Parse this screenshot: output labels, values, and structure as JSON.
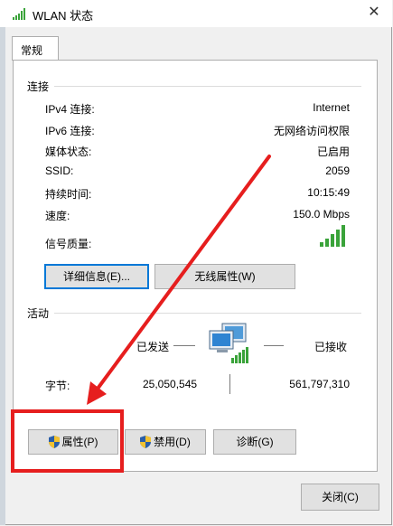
{
  "window": {
    "title": "WLAN 状态",
    "close_label": "✕"
  },
  "tabs": [
    {
      "label": "常规"
    }
  ],
  "connection": {
    "heading": "连接",
    "rows": [
      {
        "label": "IPv4 连接:",
        "value": "Internet"
      },
      {
        "label": "IPv6 连接:",
        "value": "无网络访问权限"
      },
      {
        "label": "媒体状态:",
        "value": "已启用"
      },
      {
        "label": "SSID:",
        "value": "2059"
      },
      {
        "label": "持续时间:",
        "value": "10:15:49"
      },
      {
        "label": "速度:",
        "value": "150.0 Mbps"
      }
    ],
    "signal_label": "信号质量:",
    "signal_bars": 5,
    "details_button": "详细信息(E)...",
    "wireless_props_button": "无线属性(W)"
  },
  "activity": {
    "heading": "活动",
    "sent_label": "已发送",
    "received_label": "已接收",
    "bytes_label": "字节:",
    "bytes_sent": "25,050,545",
    "bytes_received": "561,797,310"
  },
  "actions": {
    "properties_button": "属性(P)",
    "disable_button": "禁用(D)",
    "diagnose_button": "诊断(G)"
  },
  "footer": {
    "close_button": "关闭(C)"
  },
  "colors": {
    "annotation_red": "#e61e1e",
    "signal_green": "#3aa33a",
    "focus_blue": "#0078d7"
  },
  "icons": {
    "wifi": "wifi-signal-icon",
    "network": "network-computers-icon",
    "shield": "uac-shield-icon"
  }
}
